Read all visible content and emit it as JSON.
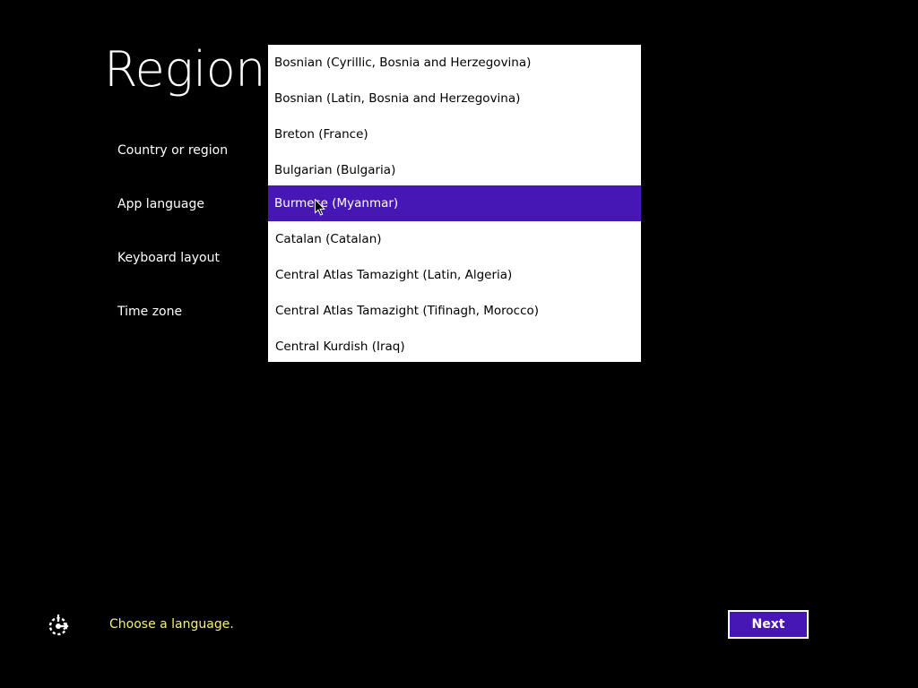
{
  "page": {
    "title": "Region"
  },
  "settings": {
    "country_label": "Country or region",
    "app_language_label": "App language",
    "keyboard_layout_label": "Keyboard layout",
    "time_zone_label": "Time zone"
  },
  "language_list": {
    "items": [
      {
        "label": "Bosnian (Cyrillic, Bosnia and Herzegovina)",
        "selected": false
      },
      {
        "label": "Bosnian (Latin, Bosnia and Herzegovina)",
        "selected": false
      },
      {
        "label": "Breton (France)",
        "selected": false
      },
      {
        "label": "Bulgarian (Bulgaria)",
        "selected": false
      },
      {
        "label": "Burmese (Myanmar)",
        "selected": true
      },
      {
        "label": "Catalan (Catalan)",
        "selected": false
      },
      {
        "label": "Central Atlas Tamazight (Latin, Algeria)",
        "selected": false
      },
      {
        "label": "Central Atlas Tamazight (Tifinagh, Morocco)",
        "selected": false
      },
      {
        "label": "Central Kurdish (Iraq)",
        "selected": false
      }
    ]
  },
  "footer": {
    "status_text": "Choose a language.",
    "next_label": "Next",
    "icon": "ease-of-access-icon"
  },
  "colors": {
    "background": "#000000",
    "accent": "#4617b4",
    "status_text": "#f4f07a",
    "list_background": "#ffffff"
  }
}
